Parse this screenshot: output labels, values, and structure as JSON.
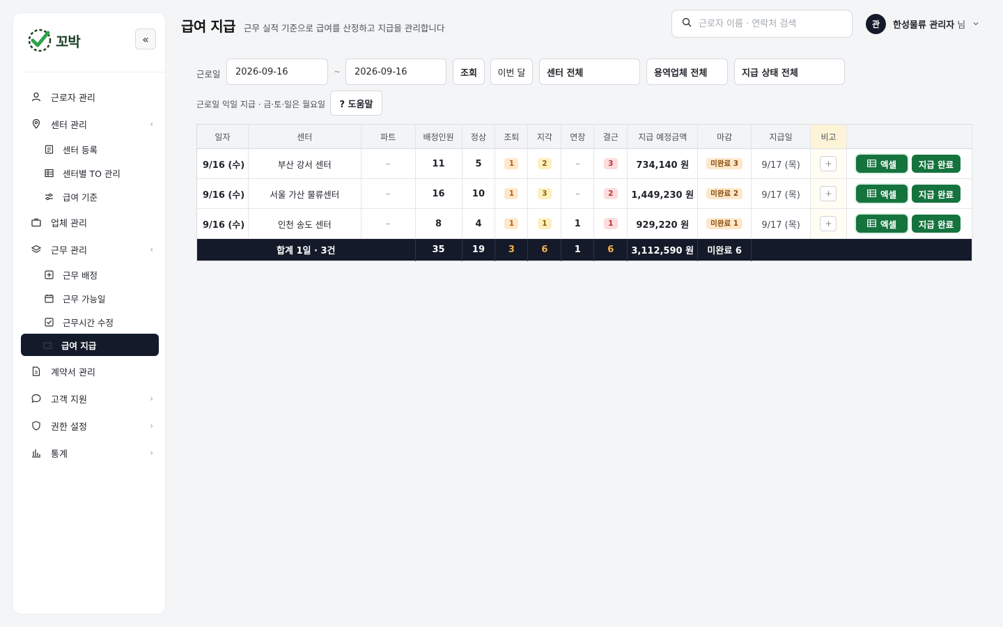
{
  "app": {
    "logo_text": "꼬박"
  },
  "sidebar": {
    "items": [
      {
        "label": "근로자 관리"
      },
      {
        "label": "센터 관리"
      },
      {
        "label": "센터 등록"
      },
      {
        "label": "센터별 TO 관리"
      },
      {
        "label": "급여 기준"
      },
      {
        "label": "업체 관리"
      },
      {
        "label": "근무 관리"
      },
      {
        "label": "근무 배정"
      },
      {
        "label": "근무 가능일"
      },
      {
        "label": "근무시간 수정"
      },
      {
        "label": "급여 지급"
      },
      {
        "label": "계약서 관리"
      },
      {
        "label": "고객 지원"
      },
      {
        "label": "권한 설정"
      },
      {
        "label": "통계"
      }
    ],
    "active": "급여 지급"
  },
  "header": {
    "title": "급여 지급",
    "subtitle": "근무 실적 기준으로 급여를 산정하고 지급을 관리합니다",
    "search_placeholder": "근로자 이름 · 연락처 검색",
    "avatar_initial": "관",
    "user_name": "한성물류 관리자",
    "user_suffix": "님"
  },
  "filters": {
    "date_label": "근로일",
    "date_from": "2026-09-16",
    "date_to": "2026-09-16",
    "tilde": "~",
    "search_btn": "조회",
    "this_month_btn": "이번 달",
    "center_select": "센터 전체",
    "vendor_select": "용역업체 전체",
    "status_select": "지급 상태 전체",
    "pay_rule_note": "근로일 익일 지급 · 금·토·일은 월요일",
    "help_btn": "? 도움말"
  },
  "table": {
    "headers": [
      "일자",
      "센터",
      "파트",
      "배정인원",
      "정상",
      "조퇴",
      "지각",
      "연장",
      "결근",
      "지급 예정금액",
      "마감",
      "지급일",
      "비고",
      ""
    ],
    "rows": [
      {
        "date": "9/16 (수)",
        "center": "부산 강서 센터",
        "part": "–",
        "assigned": "11",
        "normal": "5",
        "early": "1",
        "late": "2",
        "overtime": "–",
        "absent": "3",
        "amount": "734,140 원",
        "close": "미완료 3",
        "payday": "9/17 (목)",
        "note": "+",
        "excel": "엑셀",
        "paid": "지급 완료"
      },
      {
        "date": "9/16 (수)",
        "center": "서울 가산 물류센터",
        "part": "–",
        "assigned": "16",
        "normal": "10",
        "early": "1",
        "late": "3",
        "overtime": "–",
        "absent": "2",
        "amount": "1,449,230 원",
        "close": "미완료 2",
        "payday": "9/17 (목)",
        "note": "+",
        "excel": "엑셀",
        "paid": "지급 완료"
      },
      {
        "date": "9/16 (수)",
        "center": "인천 송도 센터",
        "part": "–",
        "assigned": "8",
        "normal": "4",
        "early": "1",
        "late": "1",
        "overtime": "1",
        "absent": "1",
        "amount": "929,220 원",
        "close": "미완료 1",
        "payday": "9/17 (목)",
        "note": "+",
        "excel": "엑셀",
        "paid": "지급 완료"
      }
    ],
    "total": {
      "label": "합계 1일 · 3건",
      "assigned": "35",
      "normal": "19",
      "early": "3",
      "late": "6",
      "overtime": "1",
      "absent": "6",
      "amount": "3,112,590 원",
      "close": "미완료 6"
    }
  },
  "colors": {
    "accent_dark": "#141a29",
    "brand_green": "#15733e",
    "badge_orange": "#fde8cc",
    "badge_red": "#fcdcdc"
  }
}
